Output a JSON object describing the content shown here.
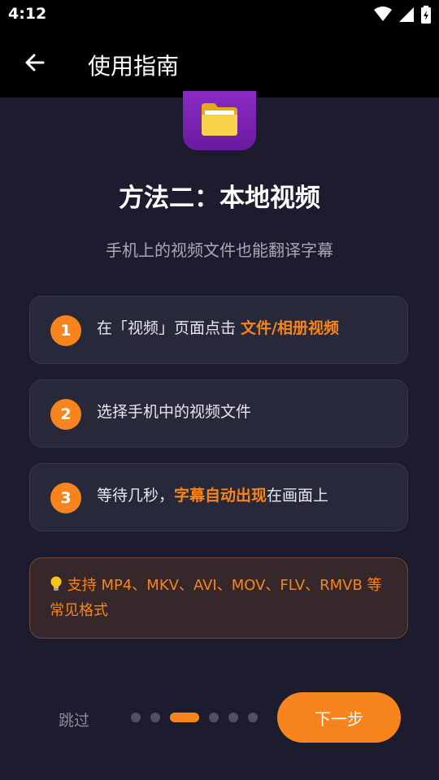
{
  "status_bar": {
    "time": "4:12",
    "icons": [
      "wifi-icon",
      "signal-icon",
      "battery-icon"
    ]
  },
  "app_bar": {
    "back_icon": "arrow-left-icon",
    "title": "使用指南"
  },
  "guide": {
    "icon": "folder-icon",
    "title": "方法二：本地视频",
    "subtitle": "手机上的视频文件也能翻译字幕",
    "steps": [
      {
        "number": "1",
        "text_before": "在「视频」页面点击 ",
        "highlight": "文件/相册视频",
        "text_after": ""
      },
      {
        "number": "2",
        "text_before": "选择手机中的视频文件",
        "highlight": "",
        "text_after": ""
      },
      {
        "number": "3",
        "text_before": "等待几秒，",
        "highlight": "字幕自动出现",
        "text_after": "在画面上"
      }
    ],
    "tip": {
      "icon": "lightbulb-icon",
      "text": "支持 MP4、MKV、AVI、MOV、FLV、RMVB 等常见格式"
    }
  },
  "navigation": {
    "skip_label": "跳过",
    "page_count": 6,
    "current_page": 3,
    "next_label": "下一步"
  },
  "colors": {
    "background": "#1c1c2e",
    "accent": "#f7841d",
    "card": "#272839",
    "tip_background": "#36282a"
  }
}
